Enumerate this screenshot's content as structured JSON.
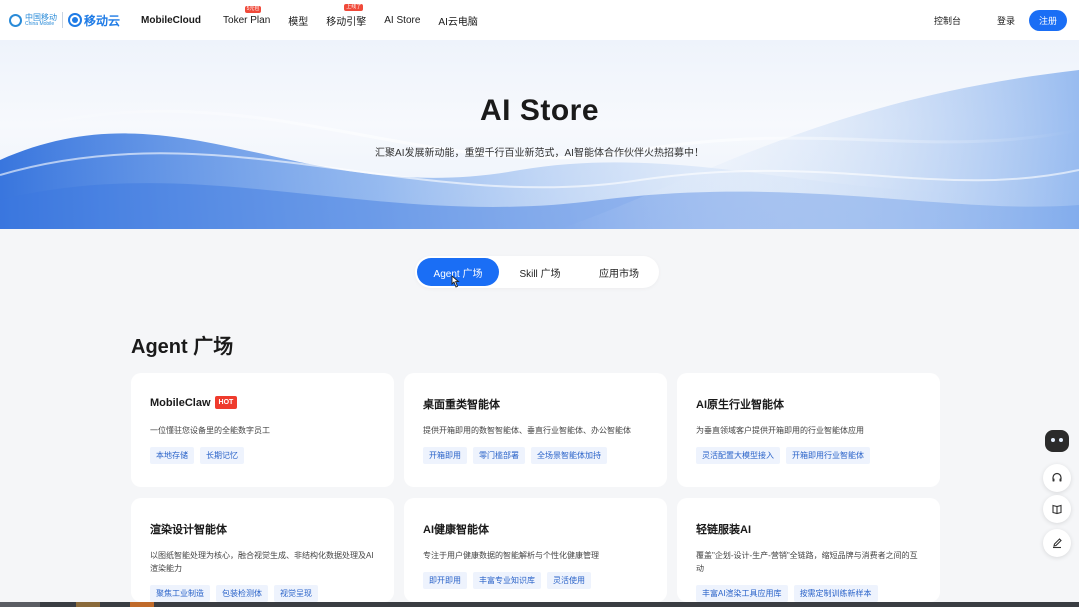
{
  "header": {
    "logo_cn": "中国移动",
    "logo_en": "China Mobile",
    "cloud_brand": "移动云",
    "nav": [
      {
        "label": "MobileCloud",
        "badge": ""
      },
      {
        "label": "Toker Plan",
        "badge": "5元包"
      },
      {
        "label": "模型",
        "badge": ""
      },
      {
        "label": "移动引擎",
        "badge": "上线了"
      },
      {
        "label": "AI Store",
        "badge": ""
      },
      {
        "label": "AI云电脑",
        "badge": ""
      }
    ],
    "console": "控制台",
    "login": "登录",
    "signup": "注册"
  },
  "hero": {
    "title": "AI Store",
    "subtitle": "汇聚AI发展新动能，重塑千行百业新范式，AI智能体合作伙伴火热招募中！"
  },
  "tabs": [
    "Agent 广场",
    "Skill 广场",
    "应用市场"
  ],
  "section_title": "Agent 广场",
  "cards": [
    {
      "title": "MobileClaw",
      "hot": "HOT",
      "desc": "一位懂驻您设备里的全能数字员工",
      "tags": [
        "本地存储",
        "长期记忆"
      ]
    },
    {
      "title": "桌面重类智能体",
      "hot": "",
      "desc": "提供开箱即用的数智智能体、垂直行业智能体、办公智能体",
      "tags": [
        "开箱即用",
        "零门槛部署",
        "全场景智能体加持"
      ]
    },
    {
      "title": "AI原生行业智能体",
      "hot": "",
      "desc": "为垂直领域客户提供开箱即用的行业智能体应用",
      "tags": [
        "灵活配置大模型接入",
        "开箱即用行业智能体"
      ]
    },
    {
      "title": "渲染设计智能体",
      "hot": "",
      "desc": "以图纸智能处理为核心，融合视觉生成、非结构化数据处理及AI 渲染能力",
      "tags": [
        "聚焦工业制造",
        "包装检测体",
        "视觉呈现"
      ]
    },
    {
      "title": "AI健康智能体",
      "hot": "",
      "desc": "专注于用户健康数据的智能解析与个性化健康管理",
      "tags": [
        "即开即用",
        "丰富专业知识库",
        "灵活使用"
      ]
    },
    {
      "title": "轻链服装AI",
      "hot": "",
      "desc": "覆盖\"企划-设计-生产-营销\"全链路，缩短品牌与消费者之间的互动",
      "tags": [
        "丰富AI渲染工具应用库",
        "按需定制训练新样本"
      ]
    }
  ],
  "side": {
    "support_icon": "headset-icon",
    "book_icon": "book-icon",
    "edit_icon": "edit-icon"
  },
  "colors": {
    "primary": "#1a6ef5",
    "hot": "#ef3b2d",
    "tag_text": "#2a63c9",
    "tag_bg": "#eef3fd"
  }
}
